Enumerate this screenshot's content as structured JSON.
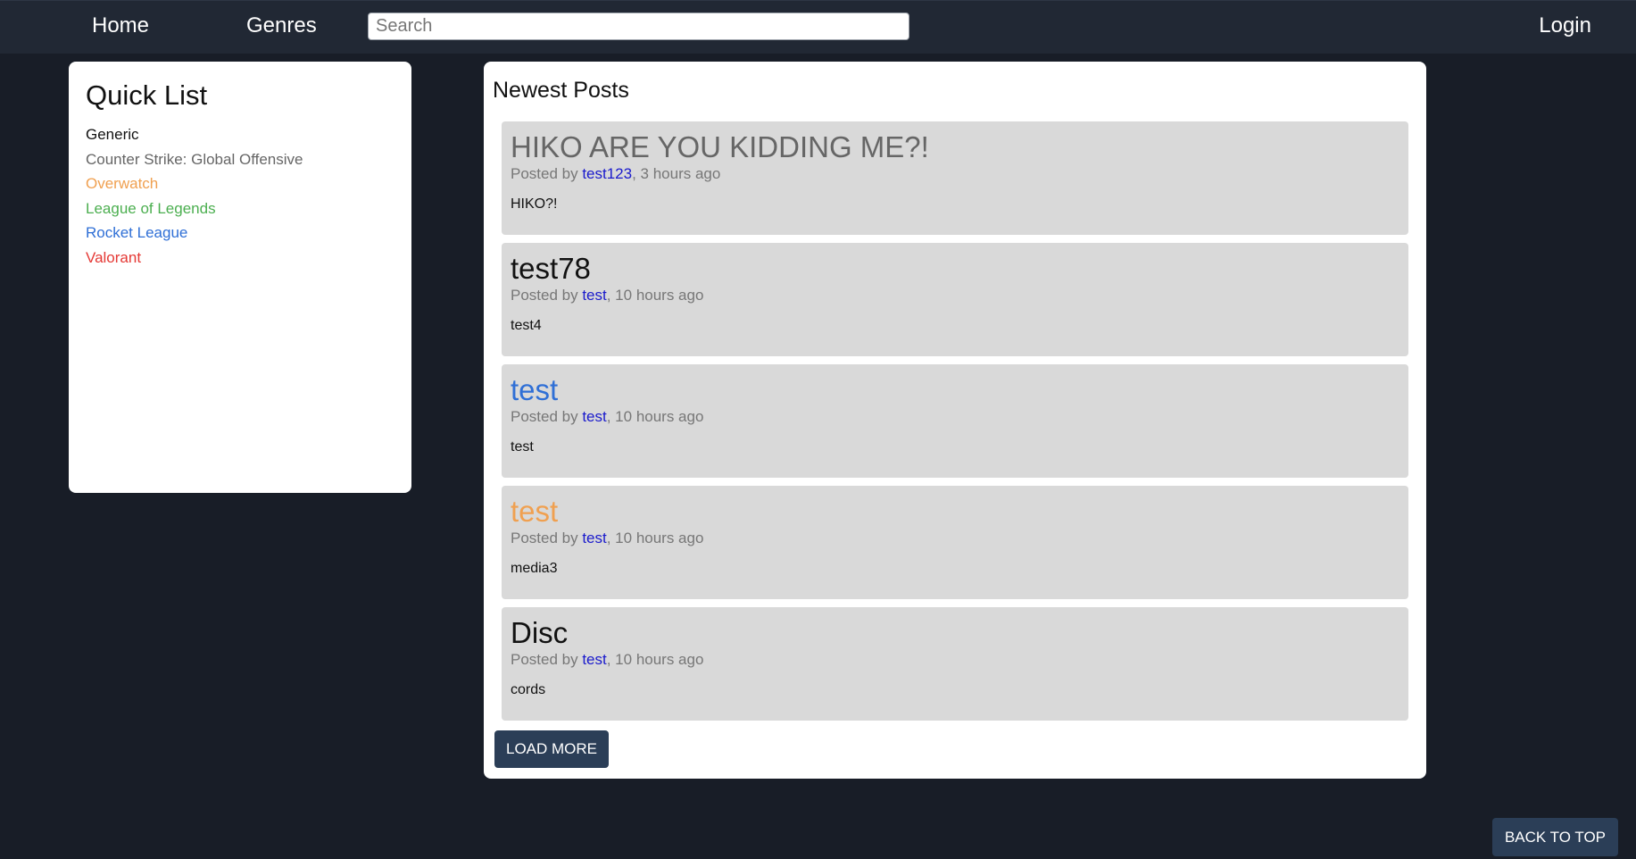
{
  "nav": {
    "home_label": "Home",
    "genres_label": "Genres",
    "search_placeholder": "Search",
    "login_label": "Login"
  },
  "quick_list": {
    "title": "Quick List",
    "items": [
      {
        "label": "Generic",
        "color": "#111111"
      },
      {
        "label": "Counter Strike: Global Offensive",
        "color": "#666666"
      },
      {
        "label": "Overwatch",
        "color": "#f0a050"
      },
      {
        "label": "League of Legends",
        "color": "#4caf50"
      },
      {
        "label": "Rocket League",
        "color": "#2f6fd6"
      },
      {
        "label": "Valorant",
        "color": "#e53935"
      }
    ]
  },
  "posts": {
    "title": "Newest Posts",
    "items": [
      {
        "title": "HIKO ARE YOU KIDDING ME?!",
        "title_color": "#666666",
        "posted_by": "Posted by ",
        "author": "test123",
        "time": ", 3 hours ago",
        "body": "HIKO?!"
      },
      {
        "title": "test78",
        "title_color": "#111111",
        "posted_by": "Posted by ",
        "author": "test",
        "time": ", 10 hours ago",
        "body": "test4"
      },
      {
        "title": "test",
        "title_color": "#2f6fd6",
        "posted_by": "Posted by ",
        "author": "test",
        "time": ", 10 hours ago",
        "body": "test"
      },
      {
        "title": "test",
        "title_color": "#f0a050",
        "posted_by": "Posted by ",
        "author": "test",
        "time": ", 10 hours ago",
        "body": "media3"
      },
      {
        "title": "Disc",
        "title_color": "#111111",
        "posted_by": "Posted by ",
        "author": "test",
        "time": ", 10 hours ago",
        "body": "cords"
      }
    ],
    "load_more_label": "LOAD MORE"
  },
  "back_to_top_label": "BACK TO TOP"
}
